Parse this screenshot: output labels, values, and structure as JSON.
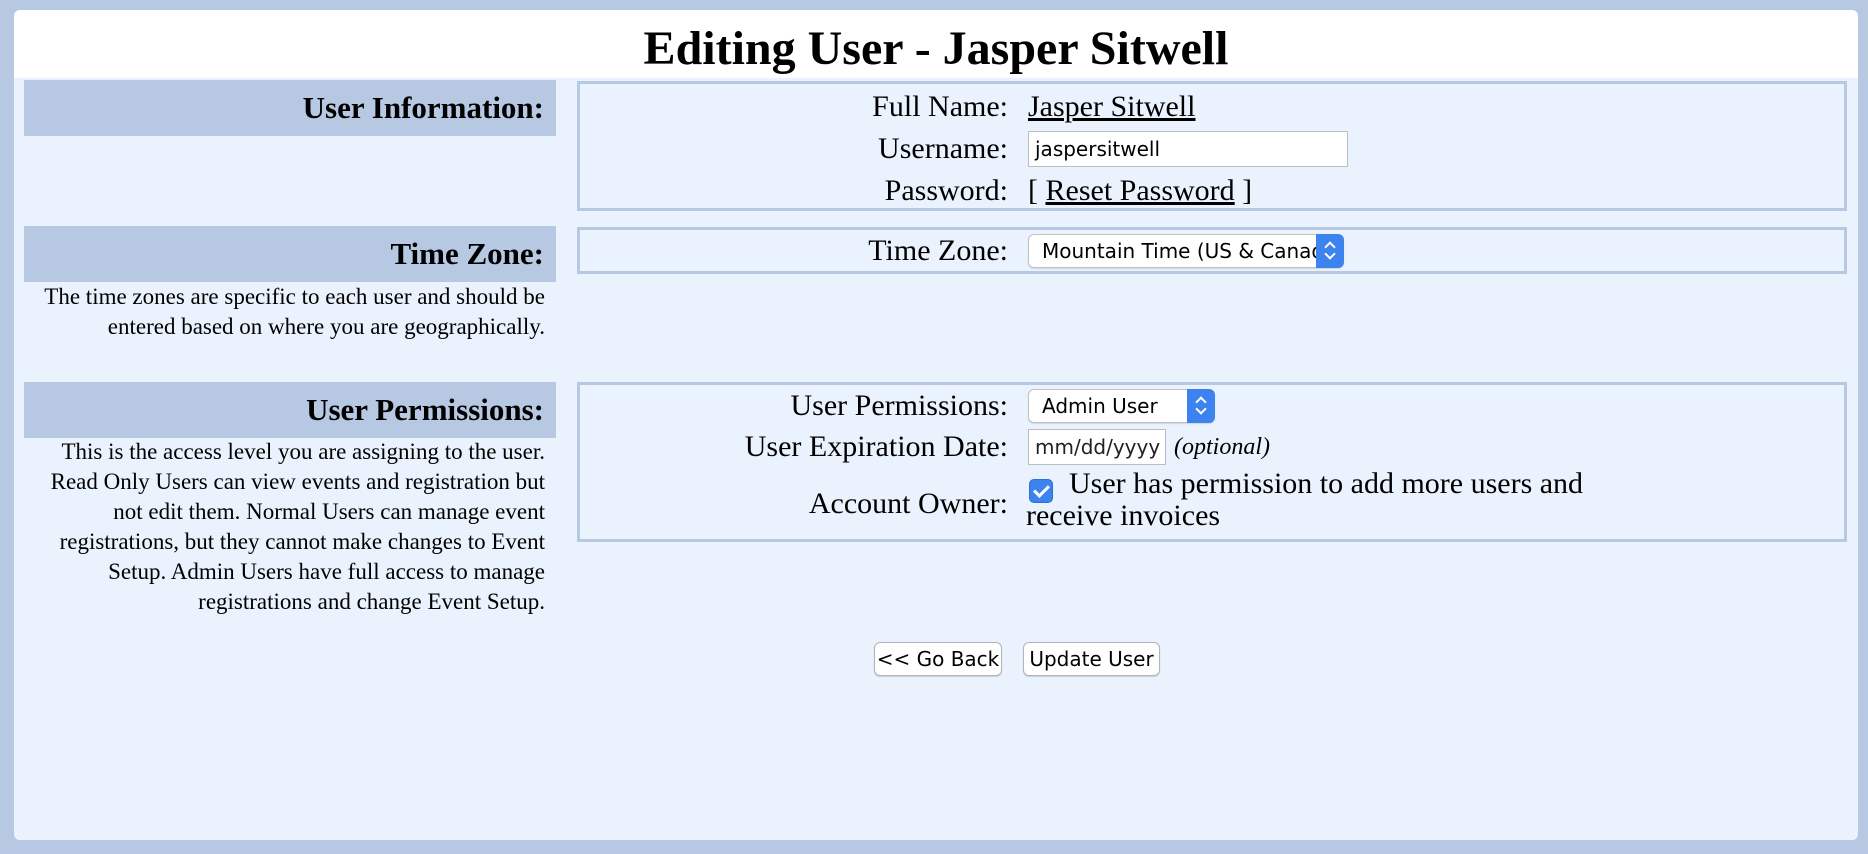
{
  "page": {
    "title": "Editing User - Jasper Sitwell"
  },
  "user_info": {
    "header": "User Information:",
    "full_name_label": "Full Name:",
    "full_name_value": "Jasper Sitwell",
    "username_label": "Username:",
    "username_value": "jaspersitwell",
    "password_label": "Password:",
    "password_bracket_open": "[",
    "reset_password_link": "Reset Password",
    "password_bracket_close": "]"
  },
  "time_zone": {
    "header": "Time Zone:",
    "description": "The time zones are specific to each user and should be entered based on where you are geographically.",
    "label": "Time Zone:",
    "selected": "Mountain Time (US & Canada)"
  },
  "permissions": {
    "header": "User Permissions:",
    "description": "This is the access level you are assigning to the user. Read Only Users can view events and registration but not edit them. Normal Users can manage event registrations, but they cannot make changes to Event Setup. Admin Users have full access to manage registrations and change Event Setup.",
    "permissions_label": "User Permissions:",
    "permissions_selected": "Admin User",
    "expiration_label": "User Expiration Date:",
    "expiration_placeholder": "mm/dd/yyyy",
    "expiration_hint": "(optional)",
    "account_owner_label": "Account Owner:",
    "account_owner_checked": true,
    "account_owner_text": "User has permission to add more users and receive invoices"
  },
  "actions": {
    "go_back_label": "<< Go Back",
    "update_label": "Update User"
  },
  "colors": {
    "page_background": "#b7c8e3",
    "content_background": "#eaf2fd",
    "header_band": "#b7c8e3",
    "accent_blue": "#3c83f0"
  }
}
